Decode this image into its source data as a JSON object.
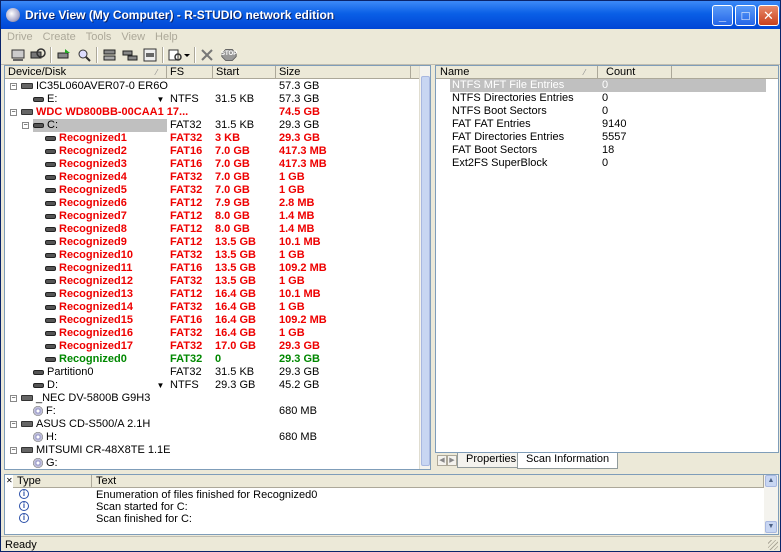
{
  "window": {
    "title": "Drive View (My Computer) - R-STUDIO network edition"
  },
  "menu": [
    "Drive",
    "Create",
    "Tools",
    "View",
    "Help"
  ],
  "toolbar": {
    "icons": [
      "drives-icon",
      "scan-icon",
      "open-drive-icon",
      "find-icon",
      "create-image-icon",
      "region-icon",
      "image-file-icon",
      "recover-icon",
      "stop-cross-icon",
      "stop-icon"
    ],
    "stop_label": "STOP"
  },
  "drive_tree": {
    "columns": [
      "Device/Disk",
      "FS",
      "Start",
      "Size"
    ],
    "rows": [
      {
        "level": 0,
        "kind": "disk",
        "expand": "-",
        "name": "IC35L060AVER07-0 ER6O",
        "fs": "",
        "start": "",
        "size": "57.3 GB",
        "style": "normal"
      },
      {
        "level": 1,
        "kind": "part",
        "expand": "",
        "name": "E:",
        "fs": "NTFS",
        "start": "31.5 KB",
        "size": "57.3 GB",
        "style": "normal",
        "dropdown": true
      },
      {
        "level": 0,
        "kind": "disk",
        "expand": "-",
        "name": "WDC WD800BB-00CAA1 17...",
        "fs": "",
        "start": "",
        "size": "74.5 GB",
        "style": "red"
      },
      {
        "level": 1,
        "kind": "part",
        "expand": "-",
        "name": "C:",
        "fs": "FAT32",
        "start": "31.5 KB",
        "size": "29.3 GB",
        "style": "selected"
      },
      {
        "level": 2,
        "kind": "part",
        "expand": "",
        "name": "Recognized1",
        "fs": "FAT32",
        "start": "3 KB",
        "size": "29.3 GB",
        "style": "red"
      },
      {
        "level": 2,
        "kind": "part",
        "expand": "",
        "name": "Recognized2",
        "fs": "FAT16",
        "start": "7.0 GB",
        "size": "417.3 MB",
        "style": "red"
      },
      {
        "level": 2,
        "kind": "part",
        "expand": "",
        "name": "Recognized3",
        "fs": "FAT16",
        "start": "7.0 GB",
        "size": "417.3 MB",
        "style": "red"
      },
      {
        "level": 2,
        "kind": "part",
        "expand": "",
        "name": "Recognized4",
        "fs": "FAT32",
        "start": "7.0 GB",
        "size": "1 GB",
        "style": "red"
      },
      {
        "level": 2,
        "kind": "part",
        "expand": "",
        "name": "Recognized5",
        "fs": "FAT32",
        "start": "7.0 GB",
        "size": "1 GB",
        "style": "red"
      },
      {
        "level": 2,
        "kind": "part",
        "expand": "",
        "name": "Recognized6",
        "fs": "FAT12",
        "start": "7.9 GB",
        "size": "2.8 MB",
        "style": "red"
      },
      {
        "level": 2,
        "kind": "part",
        "expand": "",
        "name": "Recognized7",
        "fs": "FAT12",
        "start": "8.0 GB",
        "size": "1.4 MB",
        "style": "red"
      },
      {
        "level": 2,
        "kind": "part",
        "expand": "",
        "name": "Recognized8",
        "fs": "FAT12",
        "start": "8.0 GB",
        "size": "1.4 MB",
        "style": "red"
      },
      {
        "level": 2,
        "kind": "part",
        "expand": "",
        "name": "Recognized9",
        "fs": "FAT12",
        "start": "13.5 GB",
        "size": "10.1 MB",
        "style": "red"
      },
      {
        "level": 2,
        "kind": "part",
        "expand": "",
        "name": "Recognized10",
        "fs": "FAT32",
        "start": "13.5 GB",
        "size": "1 GB",
        "style": "red"
      },
      {
        "level": 2,
        "kind": "part",
        "expand": "",
        "name": "Recognized11",
        "fs": "FAT16",
        "start": "13.5 GB",
        "size": "109.2 MB",
        "style": "red"
      },
      {
        "level": 2,
        "kind": "part",
        "expand": "",
        "name": "Recognized12",
        "fs": "FAT32",
        "start": "13.5 GB",
        "size": "1 GB",
        "style": "red"
      },
      {
        "level": 2,
        "kind": "part",
        "expand": "",
        "name": "Recognized13",
        "fs": "FAT12",
        "start": "16.4 GB",
        "size": "10.1 MB",
        "style": "red"
      },
      {
        "level": 2,
        "kind": "part",
        "expand": "",
        "name": "Recognized14",
        "fs": "FAT32",
        "start": "16.4 GB",
        "size": "1 GB",
        "style": "red"
      },
      {
        "level": 2,
        "kind": "part",
        "expand": "",
        "name": "Recognized15",
        "fs": "FAT16",
        "start": "16.4 GB",
        "size": "109.2 MB",
        "style": "red"
      },
      {
        "level": 2,
        "kind": "part",
        "expand": "",
        "name": "Recognized16",
        "fs": "FAT32",
        "start": "16.4 GB",
        "size": "1 GB",
        "style": "red"
      },
      {
        "level": 2,
        "kind": "part",
        "expand": "",
        "name": "Recognized17",
        "fs": "FAT32",
        "start": "17.0 GB",
        "size": "29.3 GB",
        "style": "red"
      },
      {
        "level": 2,
        "kind": "part",
        "expand": "",
        "name": "Recognized0",
        "fs": "FAT32",
        "start": "0",
        "size": "29.3 GB",
        "style": "green"
      },
      {
        "level": 1,
        "kind": "part",
        "expand": "",
        "name": "Partition0",
        "fs": "FAT32",
        "start": "31.5 KB",
        "size": "29.3 GB",
        "style": "normal"
      },
      {
        "level": 1,
        "kind": "part",
        "expand": "",
        "name": "D:",
        "fs": "NTFS",
        "start": "29.3 GB",
        "size": "45.2 GB",
        "style": "normal",
        "dropdown": true
      },
      {
        "level": 0,
        "kind": "disk",
        "expand": "-",
        "name": "_NEC DV-5800B G9H3",
        "fs": "",
        "start": "",
        "size": "",
        "style": "normal"
      },
      {
        "level": 1,
        "kind": "cd",
        "expand": "",
        "name": "F:",
        "fs": "",
        "start": "",
        "size": "680 MB",
        "style": "normal"
      },
      {
        "level": 0,
        "kind": "disk",
        "expand": "-",
        "name": "ASUS CD-S500/A 2.1H",
        "fs": "",
        "start": "",
        "size": "",
        "style": "normal"
      },
      {
        "level": 1,
        "kind": "cd",
        "expand": "",
        "name": "H:",
        "fs": "",
        "start": "",
        "size": "680 MB",
        "style": "normal"
      },
      {
        "level": 0,
        "kind": "disk",
        "expand": "-",
        "name": "MITSUMI CR-48X8TE 1.1E",
        "fs": "",
        "start": "",
        "size": "",
        "style": "normal"
      },
      {
        "level": 1,
        "kind": "cd",
        "expand": "",
        "name": "G:",
        "fs": "",
        "start": "",
        "size": "",
        "style": "normal"
      }
    ]
  },
  "info_panel": {
    "columns": [
      "Name",
      "Count"
    ],
    "rows": [
      {
        "name": "NTFS MFT File Entries",
        "count": "0",
        "selected": true
      },
      {
        "name": "NTFS Directories Entries",
        "count": "0"
      },
      {
        "name": "NTFS Boot Sectors",
        "count": "0"
      },
      {
        "name": "FAT FAT Entries",
        "count": "9140"
      },
      {
        "name": "FAT Directories Entries",
        "count": "5557"
      },
      {
        "name": "FAT Boot Sectors",
        "count": "18"
      },
      {
        "name": "Ext2FS SuperBlock",
        "count": "0"
      }
    ],
    "tabs": [
      "Properties",
      "Scan Information"
    ],
    "active_tab": 1
  },
  "log": {
    "columns": [
      "Type",
      "Text"
    ],
    "rows": [
      {
        "icon": "info-icon",
        "text": "Enumeration of files finished for Recognized0"
      },
      {
        "icon": "info-icon",
        "text": "Scan started for C:"
      },
      {
        "icon": "info-icon",
        "text": "Scan finished for C:"
      }
    ]
  },
  "status": {
    "text": "Ready"
  },
  "colors": {
    "title_bar": "#0a5fe6",
    "recognized": "#e00000",
    "recognized0": "#008000",
    "face": "#ece9d8"
  }
}
